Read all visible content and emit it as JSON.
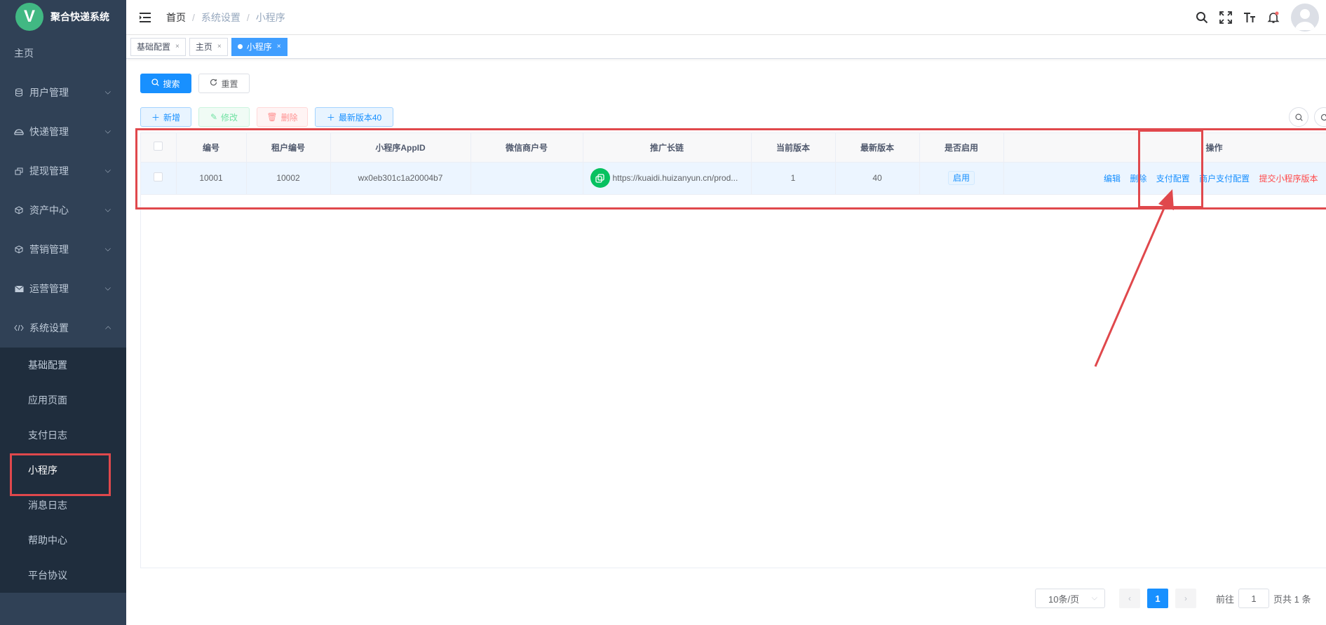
{
  "app": {
    "logo_letter": "V",
    "title": "聚合快递系统"
  },
  "sidebar": {
    "home": "主页",
    "menus": [
      {
        "label": "用户管理",
        "icon": "database-icon"
      },
      {
        "label": "快递管理",
        "icon": "courier-icon"
      },
      {
        "label": "提现管理",
        "icon": "withdraw-icon"
      },
      {
        "label": "资产中心",
        "icon": "cube-icon"
      },
      {
        "label": "营销管理",
        "icon": "cube-icon"
      },
      {
        "label": "运营管理",
        "icon": "mail-icon"
      },
      {
        "label": "系统设置",
        "icon": "code-icon"
      }
    ],
    "submenu": [
      "基础配置",
      "应用页面",
      "支付日志",
      "小程序",
      "消息日志",
      "帮助中心",
      "平台协议"
    ],
    "active_sub": "小程序"
  },
  "breadcrumb": [
    "首页",
    "系统设置",
    "小程序"
  ],
  "tags": [
    {
      "label": "基础配置",
      "active": false
    },
    {
      "label": "主页",
      "active": false
    },
    {
      "label": "小程序",
      "active": true
    }
  ],
  "search_bar": {
    "search_label": "搜索",
    "reset_label": "重置"
  },
  "toolbar": {
    "add_label": "新增",
    "edit_label": "修改",
    "delete_label": "删除",
    "latest_label": "最新版本40"
  },
  "table": {
    "headers": [
      "编号",
      "租户编号",
      "小程序AppID",
      "微信商户号",
      "推广长链",
      "当前版本",
      "最新版本",
      "是否启用",
      "操作"
    ],
    "rows": [
      {
        "id": "10001",
        "tenant": "10002",
        "appid": "wx0eb301c1a20004b7",
        "merchant": "",
        "link": "https://kuaidi.huizanyun.cn/prod...",
        "current_version": "1",
        "latest_version": "40",
        "enabled": "启用",
        "ops": [
          "编辑",
          "删除",
          "支付配置",
          "商户支付配置",
          "提交小程序版本"
        ]
      }
    ]
  },
  "pagination": {
    "page_size": "10条/页",
    "current_page": "1",
    "goto_label": "前往",
    "goto_value": "1",
    "total_label": "页共 1 条"
  },
  "colors": {
    "sidebar": "#304156",
    "primary": "#1890ff",
    "annotation": "#e0484c",
    "danger": "#ff4949"
  }
}
